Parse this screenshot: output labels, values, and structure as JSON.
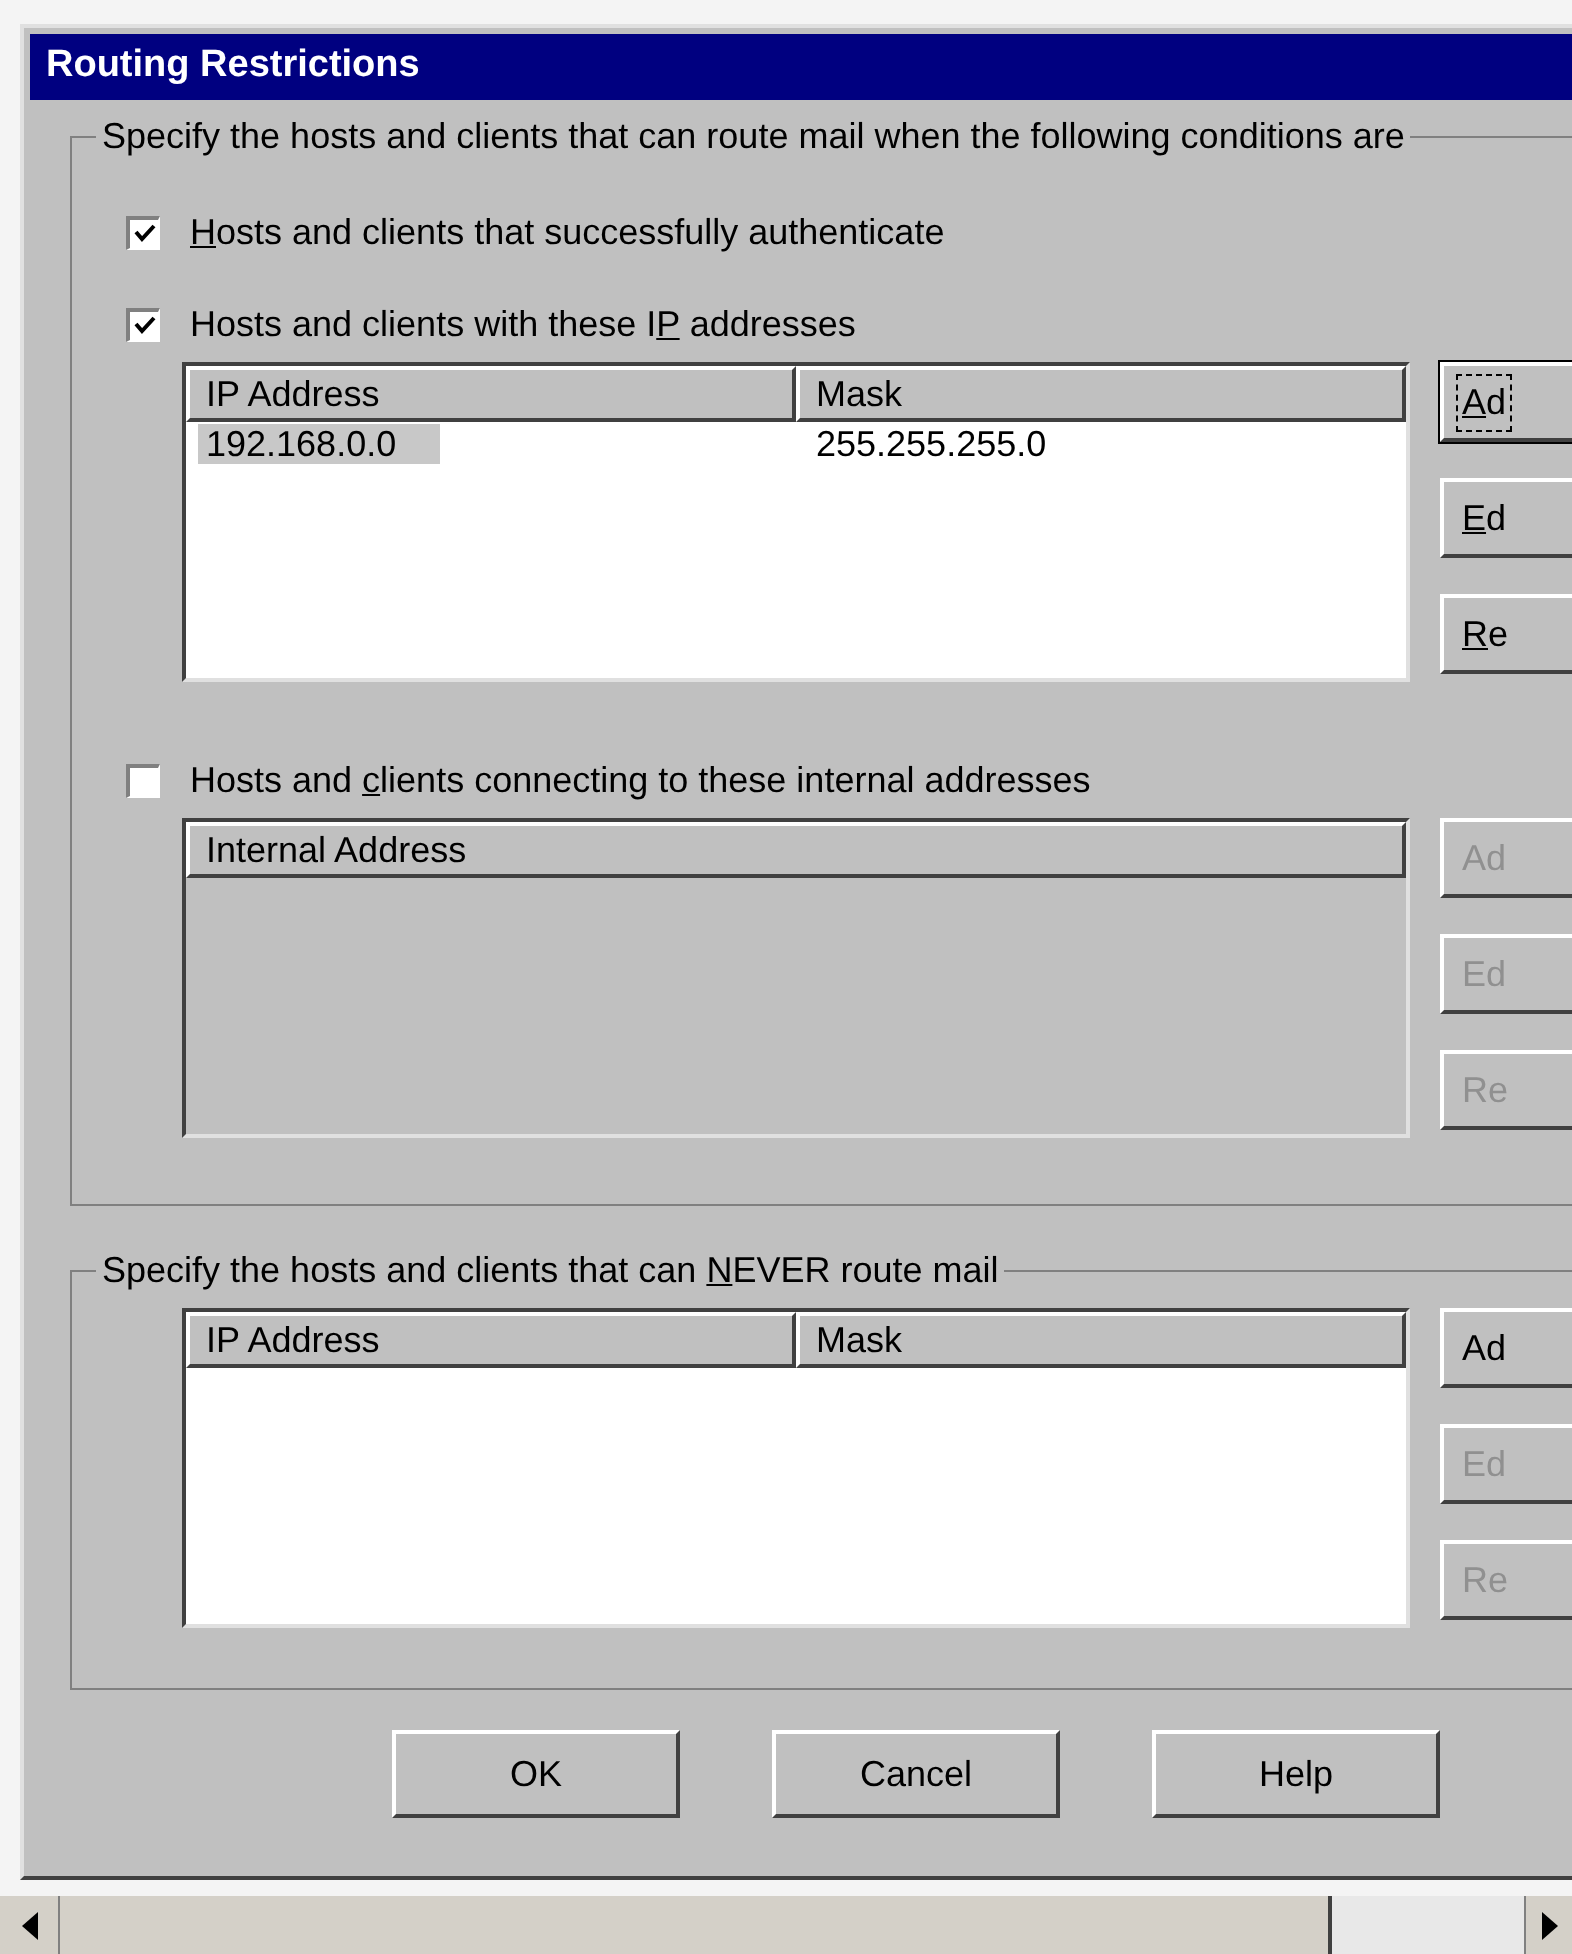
{
  "window": {
    "title": "Routing Restrictions"
  },
  "allow_group": {
    "caption": "Specify the hosts and clients that can route mail when the following conditions are",
    "options": [
      {
        "label": {
          "key": "H",
          "post": "osts and clients that successfully authenticate"
        },
        "checked": true
      },
      {
        "label": {
          "pre": "Hosts and clients with these I",
          "key": "P",
          "post": " addresses"
        },
        "checked": true,
        "list": {
          "disabled": false,
          "columns": [
            "IP Address",
            "Mask"
          ],
          "rows": [
            {
              "cells": [
                "192.168.0.0",
                "255.255.255.0"
              ],
              "selected": true
            }
          ]
        },
        "buttons": [
          {
            "label": {
              "key": "A",
              "post": "d"
            },
            "disabled": false,
            "focused": true
          },
          {
            "label": {
              "key": "E",
              "post": "d"
            },
            "disabled": false,
            "focused": false
          },
          {
            "label": {
              "key": "R",
              "post": "e"
            },
            "disabled": false,
            "focused": false
          }
        ]
      },
      {
        "label": {
          "pre": "Hosts and ",
          "key": "c",
          "post": "lients connecting to these internal addresses"
        },
        "checked": false,
        "list": {
          "disabled": true,
          "columns": [
            "Internal Address"
          ]
        },
        "buttons": [
          {
            "label": {
              "post": "Ad"
            },
            "disabled": true,
            "focused": false
          },
          {
            "label": {
              "post": "Ed"
            },
            "disabled": true,
            "focused": false
          },
          {
            "label": {
              "post": "Re"
            },
            "disabled": true,
            "focused": false
          }
        ]
      }
    ]
  },
  "deny_group": {
    "caption": {
      "pre": "Specify the hosts and clients that can ",
      "key": "N",
      "post": "EVER route mail"
    },
    "list": {
      "disabled": false,
      "columns": [
        "IP Address",
        "Mask"
      ]
    },
    "buttons": [
      {
        "label": {
          "post": "Ad"
        },
        "disabled": false,
        "focused": false
      },
      {
        "label": {
          "post": "Ed"
        },
        "disabled": true,
        "focused": false
      },
      {
        "label": {
          "post": "Re"
        },
        "disabled": true,
        "focused": false
      }
    ]
  },
  "dialog_buttons": [
    "OK",
    "Cancel",
    "Help"
  ]
}
